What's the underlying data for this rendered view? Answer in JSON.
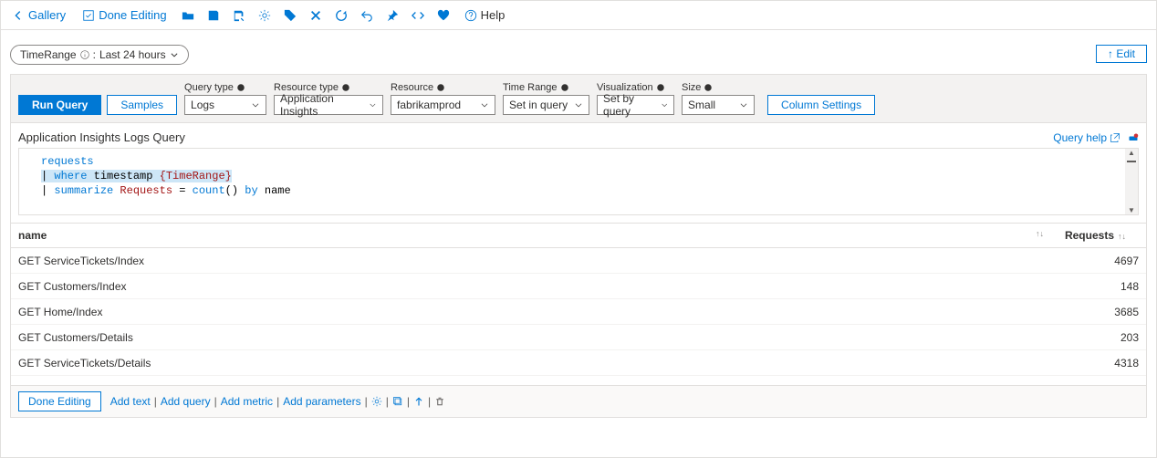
{
  "toolbar": {
    "gallery": "Gallery",
    "done_editing": "Done Editing",
    "help": "Help"
  },
  "param": {
    "name": "TimeRange",
    "value": "Last 24 hours"
  },
  "edit_button": "↑ Edit",
  "query_header": {
    "run_query": "Run Query",
    "samples": "Samples",
    "query_type": {
      "label": "Query type",
      "value": "Logs"
    },
    "resource_type": {
      "label": "Resource type",
      "value": "Application Insights"
    },
    "resource": {
      "label": "Resource",
      "value": "fabrikamprod"
    },
    "time_range": {
      "label": "Time Range",
      "value": "Set in query"
    },
    "visualization": {
      "label": "Visualization",
      "value": "Set by query"
    },
    "size": {
      "label": "Size",
      "value": "Small"
    },
    "column_settings": "Column Settings"
  },
  "subtitle": "Application Insights Logs Query",
  "query_help": "Query help",
  "editor": {
    "line1_kw": "requests",
    "line2_pipe": "|",
    "line2_kw": "where",
    "line2_ident": "timestamp",
    "line2_param": "{TimeRange}",
    "line3_pipe": "|",
    "line3_kw": "summarize",
    "line3_alias": "Requests",
    "line3_eq": "=",
    "line3_fn": "count",
    "line3_paren": "()",
    "line3_by": "by",
    "line3_col": "name"
  },
  "grid": {
    "columns": {
      "name": "name",
      "requests": "Requests"
    },
    "rows": [
      {
        "name": "GET ServiceTickets/Index",
        "requests": "4697"
      },
      {
        "name": "GET Customers/Index",
        "requests": "148"
      },
      {
        "name": "GET Home/Index",
        "requests": "3685"
      },
      {
        "name": "GET Customers/Details",
        "requests": "203"
      },
      {
        "name": "GET ServiceTickets/Details",
        "requests": "4318"
      }
    ]
  },
  "footer": {
    "done_editing": "Done Editing",
    "add_text": "Add text",
    "add_query": "Add query",
    "add_metric": "Add metric",
    "add_parameters": "Add parameters"
  }
}
